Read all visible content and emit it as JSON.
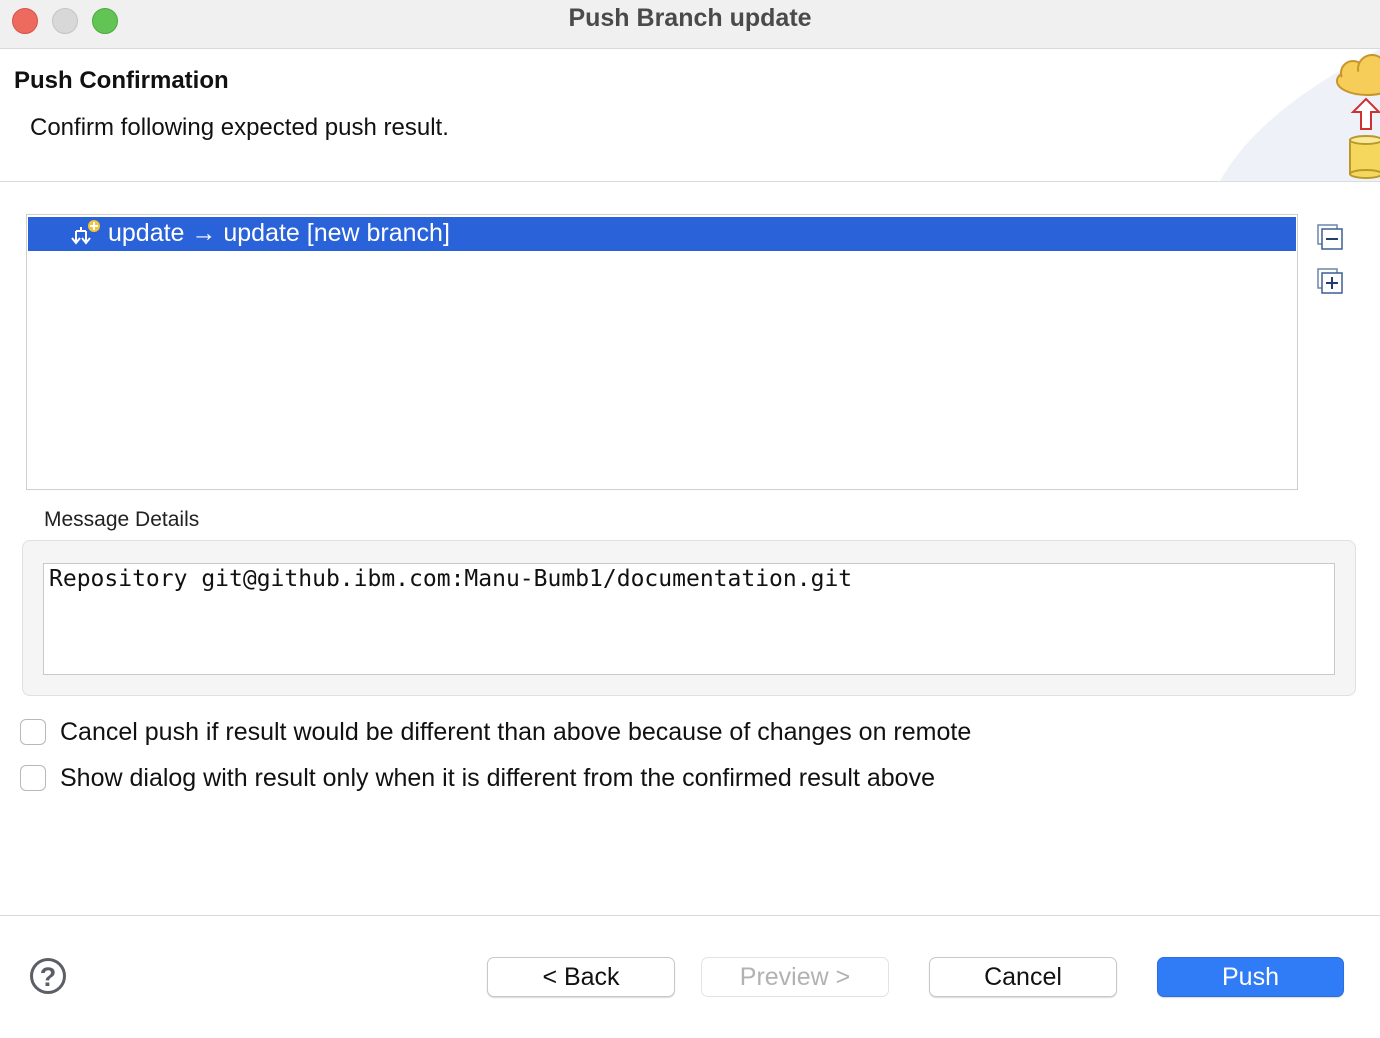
{
  "window": {
    "title": "Push Branch update"
  },
  "header": {
    "title": "Push Confirmation",
    "description": "Confirm following expected push result."
  },
  "tree": {
    "rows": [
      {
        "label": "update → update [new branch]",
        "selected": true
      }
    ]
  },
  "message_details": {
    "label": "Message Details",
    "text": "Repository git@github.ibm.com:Manu-Bumb1/documentation.git"
  },
  "options": [
    {
      "label": "Cancel push if result would be different than above because of changes on remote",
      "checked": false
    },
    {
      "label": "Show dialog with result only when it is different from the confirmed result above",
      "checked": false
    }
  ],
  "buttons": {
    "help": "?",
    "back": "< Back",
    "preview": "Preview >",
    "cancel": "Cancel",
    "push": "Push"
  },
  "colors": {
    "selection": "#2a62d9",
    "primary_button": "#2f7cf6",
    "close": "#ed6a5e",
    "maximize": "#61c454"
  }
}
